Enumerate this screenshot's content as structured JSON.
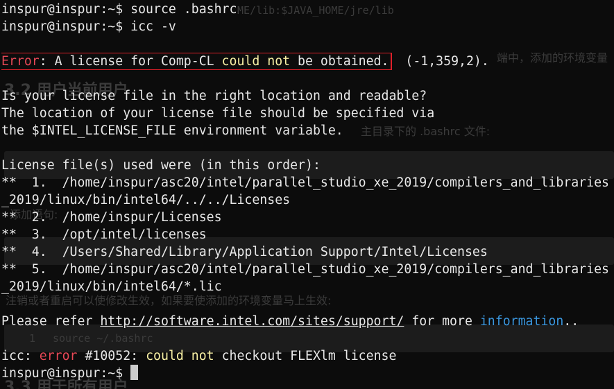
{
  "terminal": {
    "colors": {
      "background": "#0c0c0c",
      "text": "#e8e8e8",
      "error": "#e74856",
      "highlight": "#f9f1a5",
      "link_info": "#3a96dd",
      "annotation_box": "#e0202a"
    },
    "lines": [
      {
        "prompt": "inspur@inspur:~$",
        "command": " source .bashrc"
      },
      {
        "prompt": "inspur@inspur:~$",
        "command": " icc -v"
      },
      {
        "blank": ""
      },
      {
        "error_word": "Error",
        "part1": ": A license for Comp-CL ",
        "could": "could",
        "sp1": " ",
        "not": "not",
        "part2": " be obtained.",
        "tail": "  (-1,359,2)."
      },
      {
        "blank": ""
      },
      {
        "text": "Is your license file in the right location and readable?"
      },
      {
        "text": "The location of your license file should be specified via"
      },
      {
        "text": "the $INTEL_LICENSE_FILE environment variable."
      },
      {
        "blank": ""
      },
      {
        "text": "License file(s) used were (in this order):"
      },
      {
        "text": "**  1.  /home/inspur/asc20/intel/parallel_studio_xe_2019/compilers_and_libraries"
      },
      {
        "text": "_2019/linux/bin/intel64/../../Licenses"
      },
      {
        "text": "**  2.  /home/inspur/Licenses"
      },
      {
        "text": "**  3.  /opt/intel/licenses"
      },
      {
        "text": "**  4.  /Users/Shared/Library/Application Support/Intel/Licenses"
      },
      {
        "text": "**  5.  /home/inspur/asc20/intel/parallel_studio_xe_2019/compilers_and_libraries"
      },
      {
        "text": "_2019/linux/bin/intel64/*.lic"
      },
      {
        "blank": ""
      },
      {
        "pre": "Please refer ",
        "url": "http://software.intel.com/sites/support/",
        "mid": " for more ",
        "info": "information",
        "post": ".."
      },
      {
        "blank": ""
      },
      {
        "pre": "icc: ",
        "error": "error",
        "code": " #10052: ",
        "could": "could",
        "sp": " ",
        "not": "not",
        "post": " checkout FLEXlm license"
      },
      {
        "prompt": "inspur@inspur:~$",
        "command": " "
      }
    ]
  },
  "background_page": {
    "line_top": "ME/lib:$JAVA_HOME/jre/lib",
    "line_right": "端中，添加的环境变量",
    "heading1": "3.2 用户当前用户",
    "text1": "主目录下的 .bashrc 文件:",
    "text2": "添加语句:",
    "text3": "注销或者重启可以使修改生效，如果要使添加的环境变量马上生效:",
    "code_num": "1",
    "code_line": "source ~/.bashrc",
    "heading2": "3.3 用于所有用户"
  }
}
